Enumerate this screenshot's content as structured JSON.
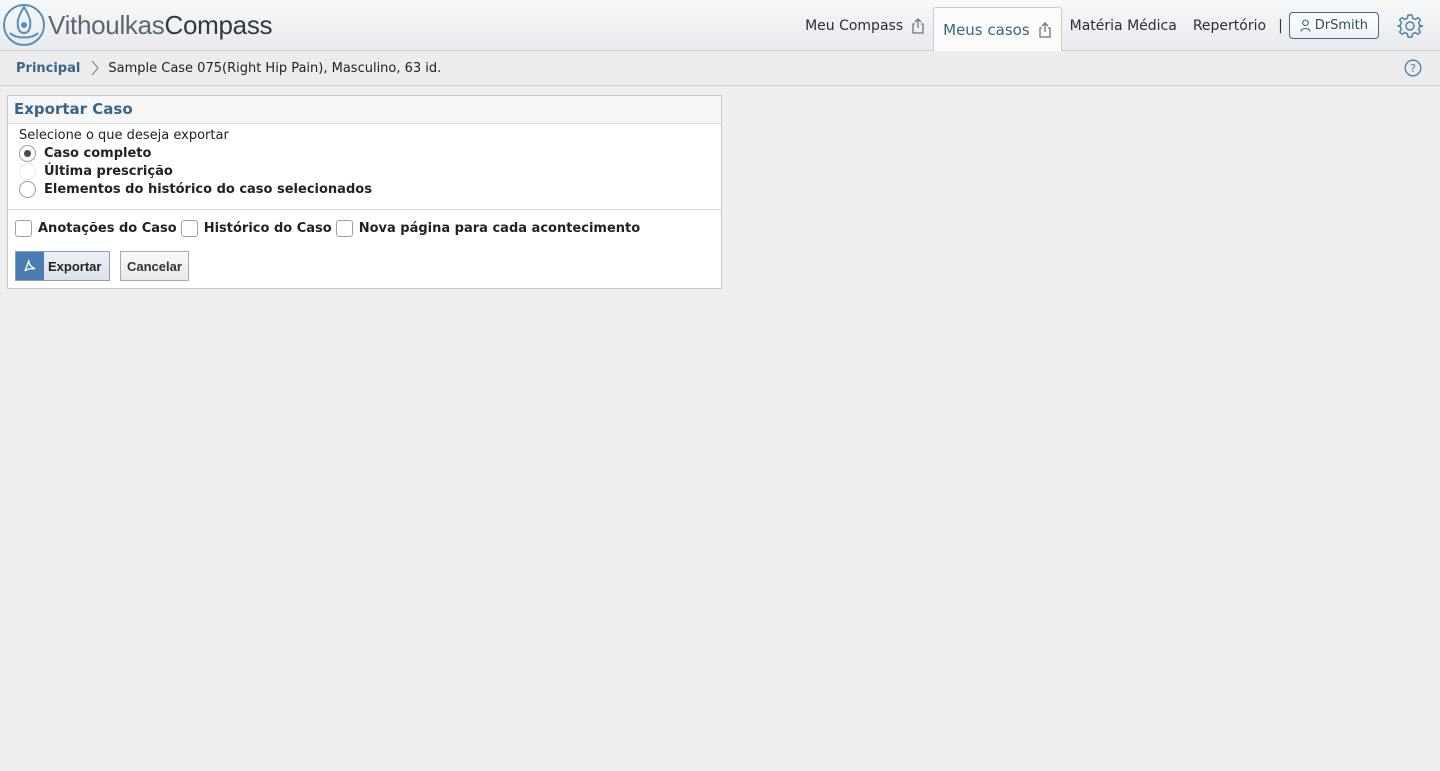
{
  "header": {
    "logo_light": "Vithoulkas",
    "logo_dark": "Compass",
    "nav": {
      "my_compass": "Meu Compass",
      "my_cases": "Meus casos",
      "materia_medica": "Matéria Médica",
      "repertory": "Repertório",
      "separator": "|",
      "user": "DrSmith"
    }
  },
  "breadcrumb": {
    "home": "Principal",
    "current": "Sample Case 075(Right Hip Pain), Masculino, 63 id."
  },
  "panel": {
    "title": "Exportar Caso",
    "prompt": "Selecione o que deseja exportar",
    "options": [
      {
        "label": "Caso completo",
        "selected": true
      },
      {
        "label": "Última prescrição",
        "selected": false
      },
      {
        "label": "Elementos do histórico do caso selecionados",
        "selected": false
      }
    ],
    "checkboxes": [
      {
        "label": "Anotações do Caso",
        "checked": false
      },
      {
        "label": "Histórico do Caso",
        "checked": false
      },
      {
        "label": "Nova página para cada acontecimento",
        "checked": false
      }
    ],
    "export_label": "Exportar",
    "cancel_label": "Cancelar"
  },
  "colors": {
    "accent": "#3a6685",
    "background": "#efefef",
    "pdf_icon_bg": "#4a7bb1"
  },
  "icons": {
    "logo": "compass-logo-icon",
    "share": "share-icon",
    "user": "user-icon",
    "settings": "gear-icon",
    "breadcrumb_separator": "chevron-right-icon",
    "help": "help-icon",
    "pdf": "pdf-icon"
  }
}
